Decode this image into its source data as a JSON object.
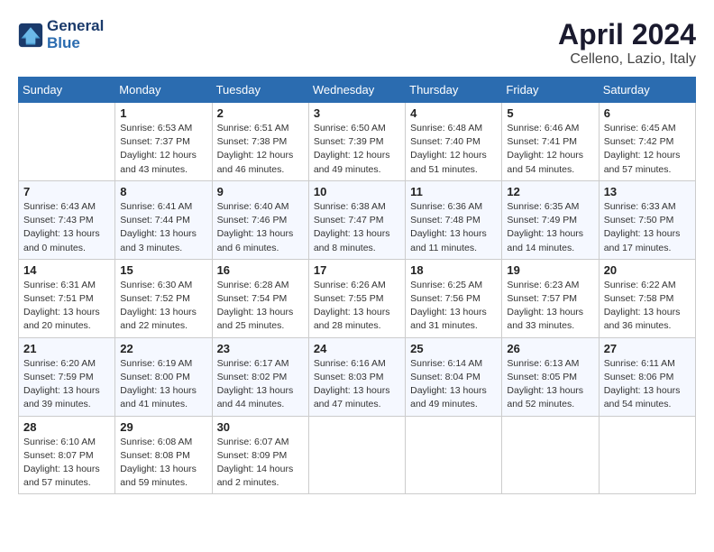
{
  "header": {
    "logo_line1": "General",
    "logo_line2": "Blue",
    "month_title": "April 2024",
    "location": "Celleno, Lazio, Italy"
  },
  "days_of_week": [
    "Sunday",
    "Monday",
    "Tuesday",
    "Wednesday",
    "Thursday",
    "Friday",
    "Saturday"
  ],
  "weeks": [
    [
      {
        "day": "",
        "sunrise": "",
        "sunset": "",
        "daylight": ""
      },
      {
        "day": "1",
        "sunrise": "Sunrise: 6:53 AM",
        "sunset": "Sunset: 7:37 PM",
        "daylight": "Daylight: 12 hours and 43 minutes."
      },
      {
        "day": "2",
        "sunrise": "Sunrise: 6:51 AM",
        "sunset": "Sunset: 7:38 PM",
        "daylight": "Daylight: 12 hours and 46 minutes."
      },
      {
        "day": "3",
        "sunrise": "Sunrise: 6:50 AM",
        "sunset": "Sunset: 7:39 PM",
        "daylight": "Daylight: 12 hours and 49 minutes."
      },
      {
        "day": "4",
        "sunrise": "Sunrise: 6:48 AM",
        "sunset": "Sunset: 7:40 PM",
        "daylight": "Daylight: 12 hours and 51 minutes."
      },
      {
        "day": "5",
        "sunrise": "Sunrise: 6:46 AM",
        "sunset": "Sunset: 7:41 PM",
        "daylight": "Daylight: 12 hours and 54 minutes."
      },
      {
        "day": "6",
        "sunrise": "Sunrise: 6:45 AM",
        "sunset": "Sunset: 7:42 PM",
        "daylight": "Daylight: 12 hours and 57 minutes."
      }
    ],
    [
      {
        "day": "7",
        "sunrise": "Sunrise: 6:43 AM",
        "sunset": "Sunset: 7:43 PM",
        "daylight": "Daylight: 13 hours and 0 minutes."
      },
      {
        "day": "8",
        "sunrise": "Sunrise: 6:41 AM",
        "sunset": "Sunset: 7:44 PM",
        "daylight": "Daylight: 13 hours and 3 minutes."
      },
      {
        "day": "9",
        "sunrise": "Sunrise: 6:40 AM",
        "sunset": "Sunset: 7:46 PM",
        "daylight": "Daylight: 13 hours and 6 minutes."
      },
      {
        "day": "10",
        "sunrise": "Sunrise: 6:38 AM",
        "sunset": "Sunset: 7:47 PM",
        "daylight": "Daylight: 13 hours and 8 minutes."
      },
      {
        "day": "11",
        "sunrise": "Sunrise: 6:36 AM",
        "sunset": "Sunset: 7:48 PM",
        "daylight": "Daylight: 13 hours and 11 minutes."
      },
      {
        "day": "12",
        "sunrise": "Sunrise: 6:35 AM",
        "sunset": "Sunset: 7:49 PM",
        "daylight": "Daylight: 13 hours and 14 minutes."
      },
      {
        "day": "13",
        "sunrise": "Sunrise: 6:33 AM",
        "sunset": "Sunset: 7:50 PM",
        "daylight": "Daylight: 13 hours and 17 minutes."
      }
    ],
    [
      {
        "day": "14",
        "sunrise": "Sunrise: 6:31 AM",
        "sunset": "Sunset: 7:51 PM",
        "daylight": "Daylight: 13 hours and 20 minutes."
      },
      {
        "day": "15",
        "sunrise": "Sunrise: 6:30 AM",
        "sunset": "Sunset: 7:52 PM",
        "daylight": "Daylight: 13 hours and 22 minutes."
      },
      {
        "day": "16",
        "sunrise": "Sunrise: 6:28 AM",
        "sunset": "Sunset: 7:54 PM",
        "daylight": "Daylight: 13 hours and 25 minutes."
      },
      {
        "day": "17",
        "sunrise": "Sunrise: 6:26 AM",
        "sunset": "Sunset: 7:55 PM",
        "daylight": "Daylight: 13 hours and 28 minutes."
      },
      {
        "day": "18",
        "sunrise": "Sunrise: 6:25 AM",
        "sunset": "Sunset: 7:56 PM",
        "daylight": "Daylight: 13 hours and 31 minutes."
      },
      {
        "day": "19",
        "sunrise": "Sunrise: 6:23 AM",
        "sunset": "Sunset: 7:57 PM",
        "daylight": "Daylight: 13 hours and 33 minutes."
      },
      {
        "day": "20",
        "sunrise": "Sunrise: 6:22 AM",
        "sunset": "Sunset: 7:58 PM",
        "daylight": "Daylight: 13 hours and 36 minutes."
      }
    ],
    [
      {
        "day": "21",
        "sunrise": "Sunrise: 6:20 AM",
        "sunset": "Sunset: 7:59 PM",
        "daylight": "Daylight: 13 hours and 39 minutes."
      },
      {
        "day": "22",
        "sunrise": "Sunrise: 6:19 AM",
        "sunset": "Sunset: 8:00 PM",
        "daylight": "Daylight: 13 hours and 41 minutes."
      },
      {
        "day": "23",
        "sunrise": "Sunrise: 6:17 AM",
        "sunset": "Sunset: 8:02 PM",
        "daylight": "Daylight: 13 hours and 44 minutes."
      },
      {
        "day": "24",
        "sunrise": "Sunrise: 6:16 AM",
        "sunset": "Sunset: 8:03 PM",
        "daylight": "Daylight: 13 hours and 47 minutes."
      },
      {
        "day": "25",
        "sunrise": "Sunrise: 6:14 AM",
        "sunset": "Sunset: 8:04 PM",
        "daylight": "Daylight: 13 hours and 49 minutes."
      },
      {
        "day": "26",
        "sunrise": "Sunrise: 6:13 AM",
        "sunset": "Sunset: 8:05 PM",
        "daylight": "Daylight: 13 hours and 52 minutes."
      },
      {
        "day": "27",
        "sunrise": "Sunrise: 6:11 AM",
        "sunset": "Sunset: 8:06 PM",
        "daylight": "Daylight: 13 hours and 54 minutes."
      }
    ],
    [
      {
        "day": "28",
        "sunrise": "Sunrise: 6:10 AM",
        "sunset": "Sunset: 8:07 PM",
        "daylight": "Daylight: 13 hours and 57 minutes."
      },
      {
        "day": "29",
        "sunrise": "Sunrise: 6:08 AM",
        "sunset": "Sunset: 8:08 PM",
        "daylight": "Daylight: 13 hours and 59 minutes."
      },
      {
        "day": "30",
        "sunrise": "Sunrise: 6:07 AM",
        "sunset": "Sunset: 8:09 PM",
        "daylight": "Daylight: 14 hours and 2 minutes."
      },
      {
        "day": "",
        "sunrise": "",
        "sunset": "",
        "daylight": ""
      },
      {
        "day": "",
        "sunrise": "",
        "sunset": "",
        "daylight": ""
      },
      {
        "day": "",
        "sunrise": "",
        "sunset": "",
        "daylight": ""
      },
      {
        "day": "",
        "sunrise": "",
        "sunset": "",
        "daylight": ""
      }
    ]
  ]
}
